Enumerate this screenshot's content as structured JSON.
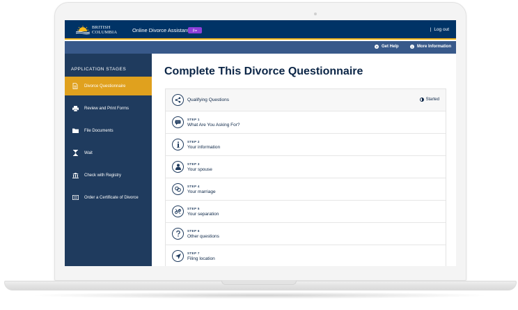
{
  "header": {
    "logo_line1": "BRITISH",
    "logo_line2": "COLUMBIA",
    "app_title": "Online Divorce Assistant",
    "beta_label": "β ▸",
    "logout_label": "Log out",
    "colors": {
      "navy": "#003366",
      "gold": "#fcba19",
      "beta": "#8e3fd8"
    }
  },
  "subnav": {
    "help_label": "Get Help",
    "help_icon": "question-circle-icon",
    "info_label": "More Information",
    "info_icon": "info-circle-icon"
  },
  "sidebar": {
    "heading": "APPLICATION STAGES",
    "items": [
      {
        "label": "Divorce Questionnaire",
        "icon": "document-icon",
        "active": true
      },
      {
        "label": "Review and Print Forms",
        "icon": "printer-icon",
        "active": false
      },
      {
        "label": "File Documents",
        "icon": "folder-icon",
        "active": false
      },
      {
        "label": "Wait",
        "icon": "hourglass-icon",
        "active": false
      },
      {
        "label": "Check with Registry",
        "icon": "courthouse-icon",
        "active": false
      },
      {
        "label": "Order a Certificate of Divorce",
        "icon": "certificate-icon",
        "active": false
      }
    ]
  },
  "main": {
    "title": "Complete This Divorce Questionnaire",
    "qualifying": {
      "label": "Qualifying Questions",
      "status": "Started",
      "icon": "share-icon"
    },
    "steps": [
      {
        "step": "STEP 1",
        "label": "What Are You Asking For?",
        "icon": "speech-bubble-icon"
      },
      {
        "step": "STEP 2",
        "label": "Your information",
        "icon": "info-icon"
      },
      {
        "step": "STEP 3",
        "label": "Your spouse",
        "icon": "person-icon"
      },
      {
        "step": "STEP 4",
        "label": "Your marriage",
        "icon": "rings-icon"
      },
      {
        "step": "STEP 5",
        "label": "Your separation",
        "icon": "broken-link-icon"
      },
      {
        "step": "STEP 6",
        "label": "Other questions",
        "icon": "question-icon"
      },
      {
        "step": "STEP 7",
        "label": "Filing location",
        "icon": "location-arrow-icon"
      }
    ]
  }
}
